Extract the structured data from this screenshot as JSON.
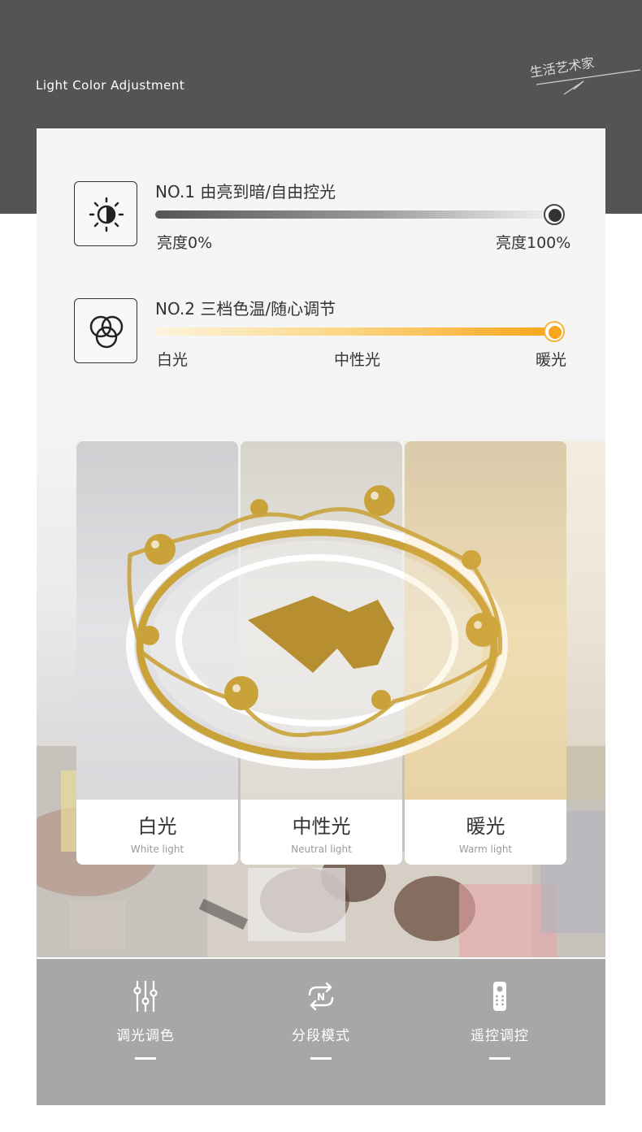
{
  "header": {
    "subtitle": "Light  Color  Adjustment",
    "brand": "生活艺术家"
  },
  "rows": [
    {
      "icon": "brightness-icon",
      "title": "NO.1  由亮到暗/自由控光",
      "left_label": "亮度0%",
      "right_label": "亮度100%",
      "value": 1.0
    },
    {
      "icon": "color-temperature-icon",
      "title": "NO.2  三档色温/随心调节",
      "left_label": "白光",
      "middle_label": "中性光",
      "right_label": "暖光",
      "value": 1.0
    }
  ],
  "modes": [
    {
      "cn": "白光",
      "en": "White light"
    },
    {
      "cn": "中性光",
      "en": "Neutral light"
    },
    {
      "cn": "暖光",
      "en": "Warm light"
    }
  ],
  "features": [
    {
      "icon": "sliders-icon",
      "label": "调光调色"
    },
    {
      "icon": "cycle-mode-icon",
      "label": "分段模式"
    },
    {
      "icon": "remote-control-icon",
      "label": "遥控调控"
    }
  ],
  "colors": {
    "dark_band": "#545454",
    "panel": "#f5f5f5",
    "bottom_band": "#a7a7a7",
    "gold": "#c9a23a",
    "warm": "#f7a51c"
  }
}
